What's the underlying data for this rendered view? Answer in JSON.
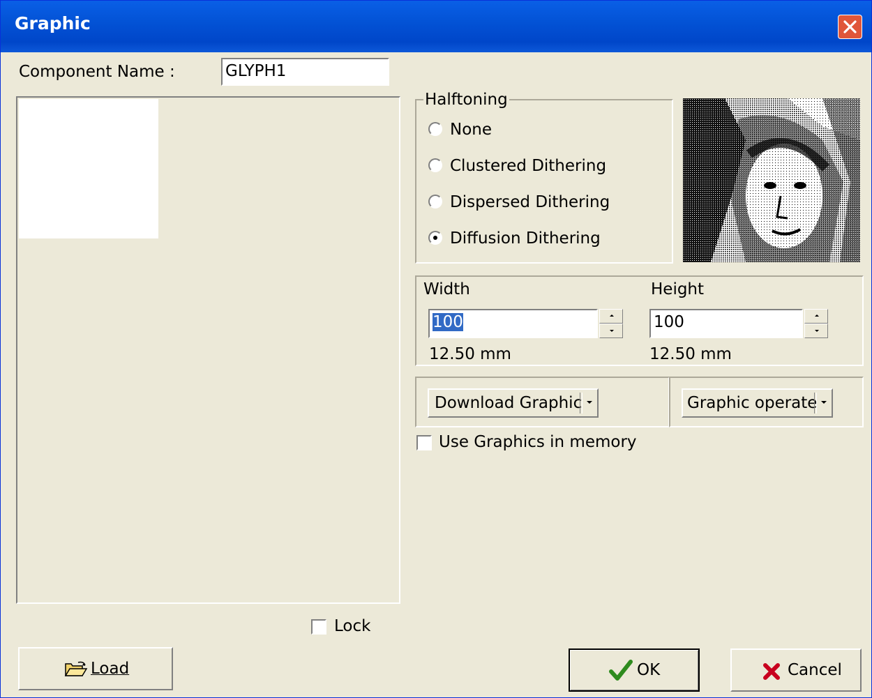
{
  "window": {
    "title": "Graphic"
  },
  "component": {
    "label": "Component Name :",
    "value": "GLYPH1"
  },
  "halftoning": {
    "label": "Halftoning",
    "options": [
      "None",
      "Clustered Dithering",
      "Dispersed Dithering",
      "Diffusion Dithering"
    ],
    "selected": "Diffusion Dithering"
  },
  "size": {
    "width_label": "Width",
    "width_value": "100",
    "width_mm": "12.50 mm",
    "height_label": "Height",
    "height_value": "100",
    "height_mm": "12.50 mm"
  },
  "buttons": {
    "download": "Download Graphic",
    "operate": "Graphic operate",
    "load": "Load",
    "ok": "OK",
    "cancel": "Cancel"
  },
  "options": {
    "use_memory": "Use Graphics in memory",
    "use_memory_checked": false,
    "lock": "Lock",
    "lock_checked": false
  },
  "icons": {
    "preview": "dithered-portrait-preview",
    "load": "open-folder-icon",
    "ok": "checkmark-icon",
    "cancel": "red-x-icon",
    "close": "close-icon"
  },
  "colors": {
    "titlebar": "#0353d6",
    "face": "#ece9d8",
    "ok_check": "#2e8b1e",
    "cancel_x": "#c8001e"
  }
}
